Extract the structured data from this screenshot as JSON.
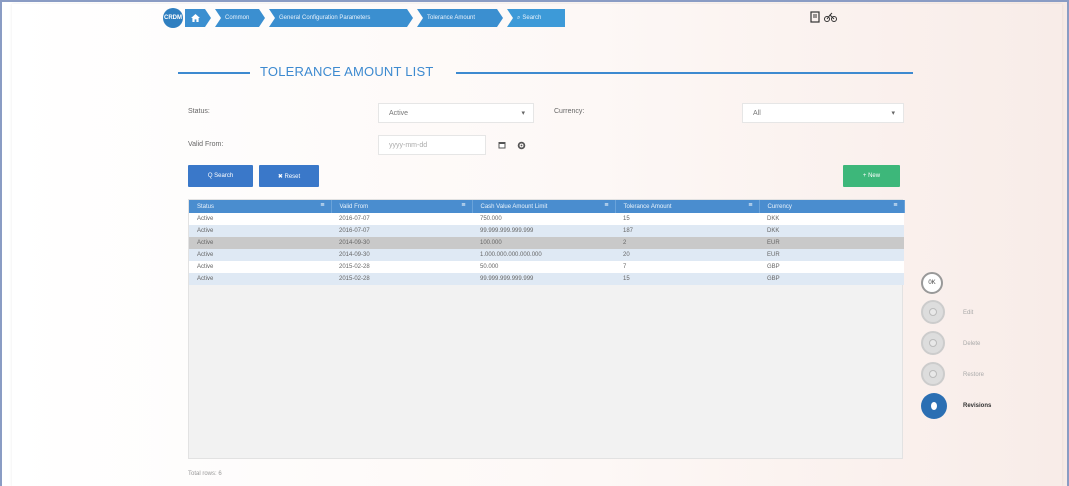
{
  "breadcrumb": {
    "logo": "CRDM",
    "home_icon": "home-icon",
    "items": [
      "Common",
      "General Configuration Parameters",
      "Tolerance Amount",
      "Search"
    ],
    "search_icon": "search-icon"
  },
  "top_icons": [
    "document-icon",
    "bicycle-icon"
  ],
  "page_title": "TOLERANCE AMOUNT LIST",
  "form": {
    "status_label": "Status:",
    "status_value": "Active",
    "currency_label": "Currency:",
    "currency_value": "All",
    "valid_from_label": "Valid From:",
    "valid_from_placeholder": "yyyy-mm-dd",
    "calendar_icon": "calendar-icon",
    "gear_icon": "gear-icon"
  },
  "buttons": {
    "search": "Q Search",
    "reset": "✖ Reset",
    "new": "+ New"
  },
  "table": {
    "columns": [
      "Status",
      "Valid From",
      "Cash Value Amount Limit",
      "Tolerance Amount",
      "Currency"
    ],
    "rows": [
      {
        "status": "Active",
        "valid_from": "2016-07-07",
        "limit": "750.000",
        "tolerance": "15",
        "currency": "DKK"
      },
      {
        "status": "Active",
        "valid_from": "2016-07-07",
        "limit": "99.999.999.999.999",
        "tolerance": "187",
        "currency": "DKK"
      },
      {
        "status": "Active",
        "valid_from": "2014-09-30",
        "limit": "100.000",
        "tolerance": "2",
        "currency": "EUR"
      },
      {
        "status": "Active",
        "valid_from": "2014-09-30",
        "limit": "1.000.000.000.000.000",
        "tolerance": "20",
        "currency": "EUR"
      },
      {
        "status": "Active",
        "valid_from": "2015-02-28",
        "limit": "50.000",
        "tolerance": "7",
        "currency": "GBP"
      },
      {
        "status": "Active",
        "valid_from": "2015-02-28",
        "limit": "99.999.999.999.999",
        "tolerance": "15",
        "currency": "GBP"
      }
    ]
  },
  "footer": "Total rows: 6",
  "stepper": {
    "first": "0K",
    "items": [
      "Edit",
      "Delete",
      "Restore",
      "Revisions"
    ]
  },
  "colors": {
    "accent": "#3d8ad0",
    "header_blue": "#4a8dcf",
    "button_blue": "#3a78c9",
    "button_green": "#3db77a",
    "highlight_row": "#c9c9c9"
  }
}
